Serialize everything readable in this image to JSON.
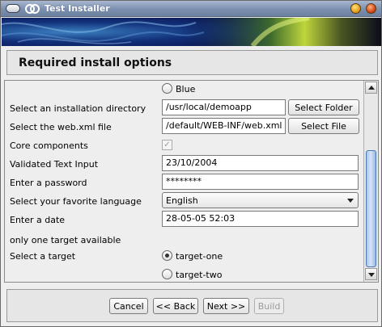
{
  "window": {
    "title": "Test Installer"
  },
  "header": {
    "title": "Required install options"
  },
  "form": {
    "radio_blue": {
      "label": "Blue",
      "selected": false
    },
    "install_dir": {
      "label": "Select an installation directory",
      "value": "/usr/local/demoapp",
      "button": "Select Folder"
    },
    "webxml": {
      "label": "Select the web.xml file",
      "value": "/default/WEB-INF/web.xml",
      "button": "Select File"
    },
    "core": {
      "label": "Core components",
      "checked": true,
      "enabled": false
    },
    "validated": {
      "label": "Validated Text Input",
      "value": "23/10/2004"
    },
    "password": {
      "label": "Enter a password",
      "value": "********"
    },
    "language": {
      "label": "Select your favorite language",
      "value": "English"
    },
    "date": {
      "label": "Enter a date",
      "value": "28-05-05 52:03"
    },
    "note": "only one target available",
    "target": {
      "label": "Select a target",
      "options": [
        "target-one",
        "target-two"
      ],
      "selected": "target-one"
    }
  },
  "footer": {
    "cancel": "Cancel",
    "back": "<< Back",
    "next": "Next >>",
    "build": "Build"
  },
  "icons": {
    "check": "✓"
  },
  "colors": {
    "titlebar": "#7b8fae",
    "scroll_thumb": "#a9c4ea",
    "banner_bg": "#0a1550",
    "banner_glow": "#c8e03a"
  }
}
